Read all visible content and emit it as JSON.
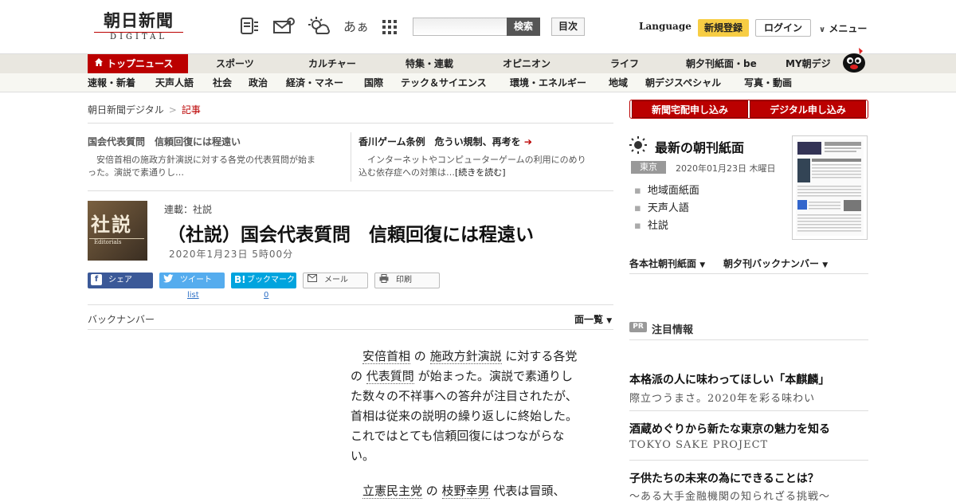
{
  "header": {
    "logo_jp": "朝日新聞",
    "logo_en": "DIGITAL",
    "font_size_toggle": "あぁ",
    "search_button": "検索",
    "toc_button": "目次",
    "language": "Language",
    "register": "新規登録",
    "login": "ログイン",
    "menu": "メニュー"
  },
  "nav_primary": [
    "トップニュース",
    "スポーツ",
    "カルチャー",
    "特集・連載",
    "オピニオン",
    "ライフ",
    "朝夕刊紙面・be",
    "MY朝デジ"
  ],
  "nav_secondary": [
    "速報・新着",
    "天声人語",
    "社会",
    "政治",
    "経済・マネー",
    "国際",
    "テック＆サイエンス",
    "環境・エネルギー",
    "地域",
    "朝デジスペシャル",
    "写真・動画"
  ],
  "breadcrumb": {
    "home": "朝日新聞デジタル",
    "sep": ">",
    "current": "記事"
  },
  "related": [
    {
      "title": "国会代表質問　信頼回復には程遠い",
      "text_line1": "　安倍首相の施政方針演説に対する各党の代表質問が始ま",
      "text_line2": "った。演説で素通りし…"
    },
    {
      "title": "香川ゲーム条例　危うい規制、再考を",
      "text_line1": "　インターネットやコンピューターゲームの利用にのめり",
      "text_line2": "込む依存症への対策は…",
      "more": "[続きを読む]"
    }
  ],
  "article": {
    "eyecatch_jp": "社説",
    "eyecatch_en": "Editorials",
    "series": "連載：社説",
    "title": "（社説）国会代表質問　信頼回復には程遠い",
    "date": "2020年1月23日 5時00分",
    "body": {
      "p1_kw1": "安倍首相",
      "p1_t1": " の ",
      "p1_kw2": "施政方針演説",
      "p1_t2": " に対する各党",
      "p1_line2_t1": "の ",
      "p1_kw3": "代表質問",
      "p1_line2_t2": " が始まった。演説で素通りし",
      "p1_line3": "た数々の不祥事への答弁が注目されたが、",
      "p1_line4": "首相は従来の説明の繰り返しに終始した。",
      "p1_line5": "これではとても信頼回復にはつながらな",
      "p1_line6": "い。",
      "p2_kw1": "立憲民主党",
      "p2_t1": " の ",
      "p2_kw2": "枝野幸男",
      "p2_t2": " 代表は冒頭、"
    }
  },
  "share": {
    "facebook": "シェア",
    "twitter": "ツイート",
    "twitter_count": "list",
    "hatena": "ブックマーク",
    "hatena_count": "0",
    "mail": "メール",
    "print": "印刷"
  },
  "backnumber": "バックナンバー",
  "men_list": "面一覧",
  "sidebar": {
    "btn_home_delivery": "新聞宅配申し込み",
    "btn_digital": "デジタル申し込み",
    "choukan_title": "最新の朝刊紙面",
    "region": "東京",
    "date": "2020年01月23日 木曜日",
    "links": [
      "地域面紙面",
      "天声人語",
      "社説"
    ],
    "dropdown1": "各本社朝刊紙面",
    "dropdown2": "朝夕刊バックナンバー",
    "pr_badge": "PR",
    "pr_head": "注目情報",
    "ads": [
      {
        "title": "本格派の人に味わってほしい「本麒麟」",
        "sub": "際立つうまさ。2020年を彩る味わい"
      },
      {
        "title": "酒蔵めぐりから新たな東京の魅力を知る",
        "sub": "TOKYO SAKE PROJECT"
      },
      {
        "title": "子供たちの未来の為にできることは？",
        "sub": "～ある大手金融機関の知られざる挑戦～"
      }
    ]
  },
  "colors": {
    "brand_red": "#bb0000",
    "register_yellow": "#f7cd44",
    "facebook": "#3b5998",
    "twitter": "#55acee",
    "hatena": "#00a4de"
  },
  "icons": [
    "newspaper-list-icon",
    "mail-icon",
    "weather-icon",
    "grid-menu-icon",
    "home-icon",
    "sun-icon"
  ]
}
